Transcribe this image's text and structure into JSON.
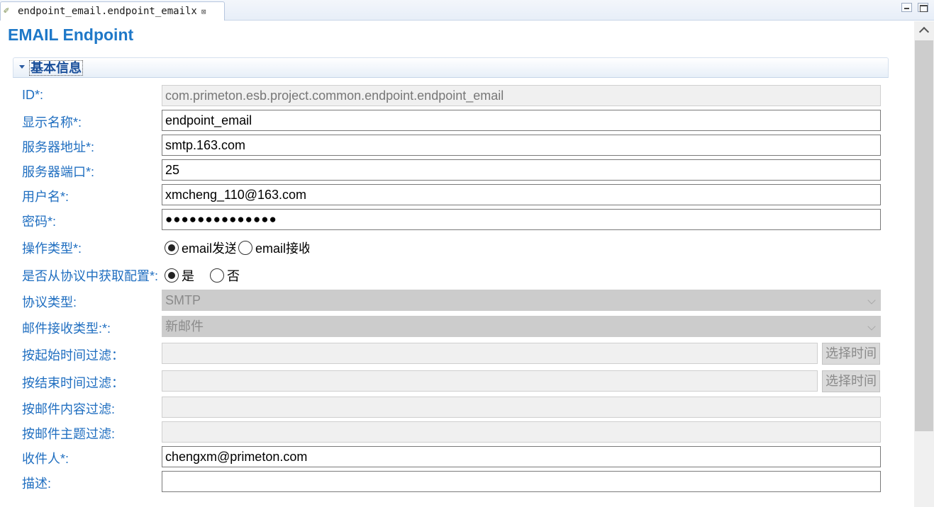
{
  "tab": {
    "title": "endpoint_email.endpoint_emailx",
    "close": "⊠"
  },
  "page": {
    "title": "EMAIL Endpoint"
  },
  "section": {
    "title": "基本信息"
  },
  "fields": {
    "id": {
      "label": "ID*:",
      "value": "com.primeton.esb.project.common.endpoint.endpoint_email"
    },
    "display_name": {
      "label": "显示名称*:",
      "value": "endpoint_email"
    },
    "server_address": {
      "label": "服务器地址*:",
      "value": "smtp.163.com"
    },
    "server_port": {
      "label": "服务器端口*:",
      "value": "25"
    },
    "username": {
      "label": "用户名*:",
      "value": "xmcheng_110@163.com"
    },
    "password": {
      "label": "密码*:",
      "value": "●●●●●●●●●●●●●●"
    },
    "operation_type": {
      "label": "操作类型*:",
      "options": [
        "email发送",
        "email接收"
      ],
      "selected": 0
    },
    "from_protocol": {
      "label": "是否从协议中获取配置*:",
      "options": [
        "是",
        "否"
      ],
      "selected": 0
    },
    "protocol_type": {
      "label": "协议类型:",
      "value": "SMTP"
    },
    "receive_type": {
      "label": "邮件接收类型:*:",
      "value": "新邮件"
    },
    "filter_start_time": {
      "label": "按起始时间过滤：",
      "value": "",
      "button": "选择时间"
    },
    "filter_end_time": {
      "label": "按结束时间过滤：",
      "value": "",
      "button": "选择时间"
    },
    "filter_content": {
      "label": "按邮件内容过滤:",
      "value": ""
    },
    "filter_subject": {
      "label": "按邮件主题过滤:",
      "value": ""
    },
    "recipient": {
      "label": "收件人*:",
      "value": "chengxm@primeton.com"
    },
    "description": {
      "label": "描述:",
      "value": ""
    }
  },
  "colors": {
    "label": "#1f6ec0",
    "title": "#1e78c8",
    "disabled": "#cccccc"
  }
}
